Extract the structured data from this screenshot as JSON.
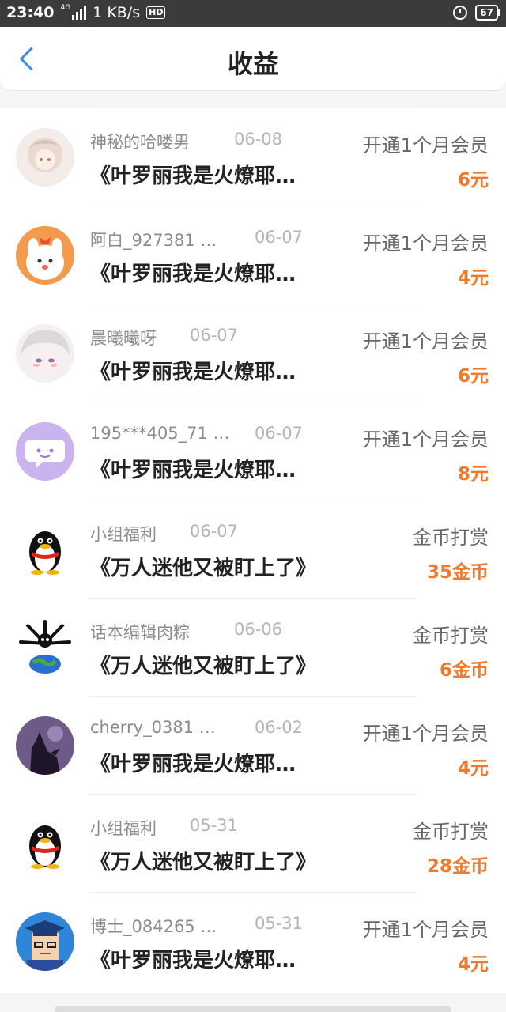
{
  "status_bar": {
    "time": "23:40",
    "network": "4G",
    "speed": "1 KB/s",
    "hd": "HD",
    "battery": "67"
  },
  "header": {
    "title": "收益"
  },
  "colors": {
    "accent": "#3a8cf0",
    "amount": "#f07a2a"
  },
  "items": [
    {
      "name": "神秘的哈喽男",
      "date": "06-08",
      "type": "开通1个月会员",
      "book": "《叶罗丽我是火燎耶…",
      "amount": "6元",
      "avatar": "anime-girl-white-hair"
    },
    {
      "name": "阿白_927381 …",
      "date": "06-07",
      "type": "开通1个月会员",
      "book": "《叶罗丽我是火燎耶…",
      "amount": "4元",
      "avatar": "cartoon-bunny"
    },
    {
      "name": "晨曦曦呀",
      "date": "06-07",
      "type": "开通1个月会员",
      "book": "《叶罗丽我是火燎耶…",
      "amount": "6元",
      "avatar": "anime-white-hair"
    },
    {
      "name": "195***405_71 …",
      "date": "06-07",
      "type": "开通1个月会员",
      "book": "《叶罗丽我是火燎耶…",
      "amount": "8元",
      "avatar": "purple-chat-bubble"
    },
    {
      "name": "小组福利",
      "date": "06-07",
      "type": "金币打赏",
      "book": "《万人迷他又被盯上了》",
      "amount": "35金币",
      "avatar": "qq-penguin"
    },
    {
      "name": "话本编辑肉粽",
      "date": "06-06",
      "type": "金币打赏",
      "book": "《万人迷他又被盯上了》",
      "amount": "6金币",
      "avatar": "bones-earth"
    },
    {
      "name": "cherry_0381 …",
      "date": "06-02",
      "type": "开通1个月会员",
      "book": "《叶罗丽我是火燎耶…",
      "amount": "4元",
      "avatar": "purple-silhouette"
    },
    {
      "name": "小组福利",
      "date": "05-31",
      "type": "金币打赏",
      "book": "《万人迷他又被盯上了》",
      "amount": "28金币",
      "avatar": "qq-penguin"
    },
    {
      "name": "博士_084265 …",
      "date": "05-31",
      "type": "开通1个月会员",
      "book": "《叶罗丽我是火燎耶…",
      "amount": "4元",
      "avatar": "graduate-boy"
    }
  ]
}
